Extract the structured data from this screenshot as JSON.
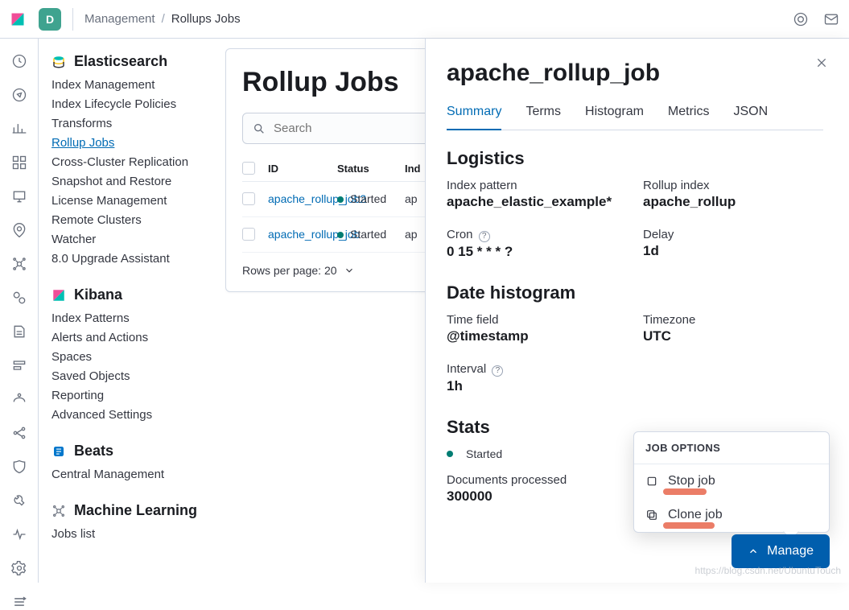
{
  "header": {
    "space_initial": "D",
    "breadcrumb_root": "Management",
    "breadcrumb_current": "Rollups Jobs"
  },
  "sidebar": {
    "sections": [
      {
        "title": "Elasticsearch",
        "items": [
          {
            "label": "Index Management",
            "active": false
          },
          {
            "label": "Index Lifecycle Policies",
            "active": false
          },
          {
            "label": "Transforms",
            "active": false
          },
          {
            "label": "Rollup Jobs",
            "active": true
          },
          {
            "label": "Cross-Cluster Replication",
            "active": false
          },
          {
            "label": "Snapshot and Restore",
            "active": false
          },
          {
            "label": "License Management",
            "active": false
          },
          {
            "label": "Remote Clusters",
            "active": false
          },
          {
            "label": "Watcher",
            "active": false
          },
          {
            "label": "8.0 Upgrade Assistant",
            "active": false
          }
        ]
      },
      {
        "title": "Kibana",
        "items": [
          {
            "label": "Index Patterns",
            "active": false
          },
          {
            "label": "Alerts and Actions",
            "active": false
          },
          {
            "label": "Spaces",
            "active": false
          },
          {
            "label": "Saved Objects",
            "active": false
          },
          {
            "label": "Reporting",
            "active": false
          },
          {
            "label": "Advanced Settings",
            "active": false
          }
        ]
      },
      {
        "title": "Beats",
        "items": [
          {
            "label": "Central Management",
            "active": false
          }
        ]
      },
      {
        "title": "Machine Learning",
        "items": [
          {
            "label": "Jobs list",
            "active": false
          }
        ]
      }
    ]
  },
  "main": {
    "title": "Rollup Jobs",
    "search_placeholder": "Search",
    "columns": {
      "id": "ID",
      "status": "Status",
      "index": "Ind"
    },
    "rows": [
      {
        "id": "apache_rollup_job2",
        "status": "Started",
        "index": "ap"
      },
      {
        "id": "apache_rollup_job",
        "status": "Started",
        "index": "ap"
      }
    ],
    "pager": "Rows per page: 20"
  },
  "flyout": {
    "title": "apache_rollup_job",
    "tabs": [
      "Summary",
      "Terms",
      "Histogram",
      "Metrics",
      "JSON"
    ],
    "active_tab": 0,
    "logistics_heading": "Logistics",
    "logistics": {
      "index_pattern_label": "Index pattern",
      "index_pattern": "apache_elastic_example*",
      "rollup_index_label": "Rollup index",
      "rollup_index": "apache_rollup",
      "cron_label": "Cron",
      "cron": "0 15 * * * ?",
      "delay_label": "Delay",
      "delay": "1d"
    },
    "date_hist_heading": "Date histogram",
    "date_hist": {
      "time_field_label": "Time field",
      "time_field": "@timestamp",
      "timezone_label": "Timezone",
      "timezone": "UTC",
      "interval_label": "Interval",
      "interval": "1h"
    },
    "stats_heading": "Stats",
    "stats": {
      "status": "Started",
      "docs_label": "Documents processed",
      "docs": "300000"
    },
    "manage": {
      "button": "Manage",
      "title": "JOB OPTIONS",
      "stop": "Stop job",
      "clone": "Clone job"
    }
  },
  "watermark": "https://blog.csdn.net/UbuntuTouch"
}
